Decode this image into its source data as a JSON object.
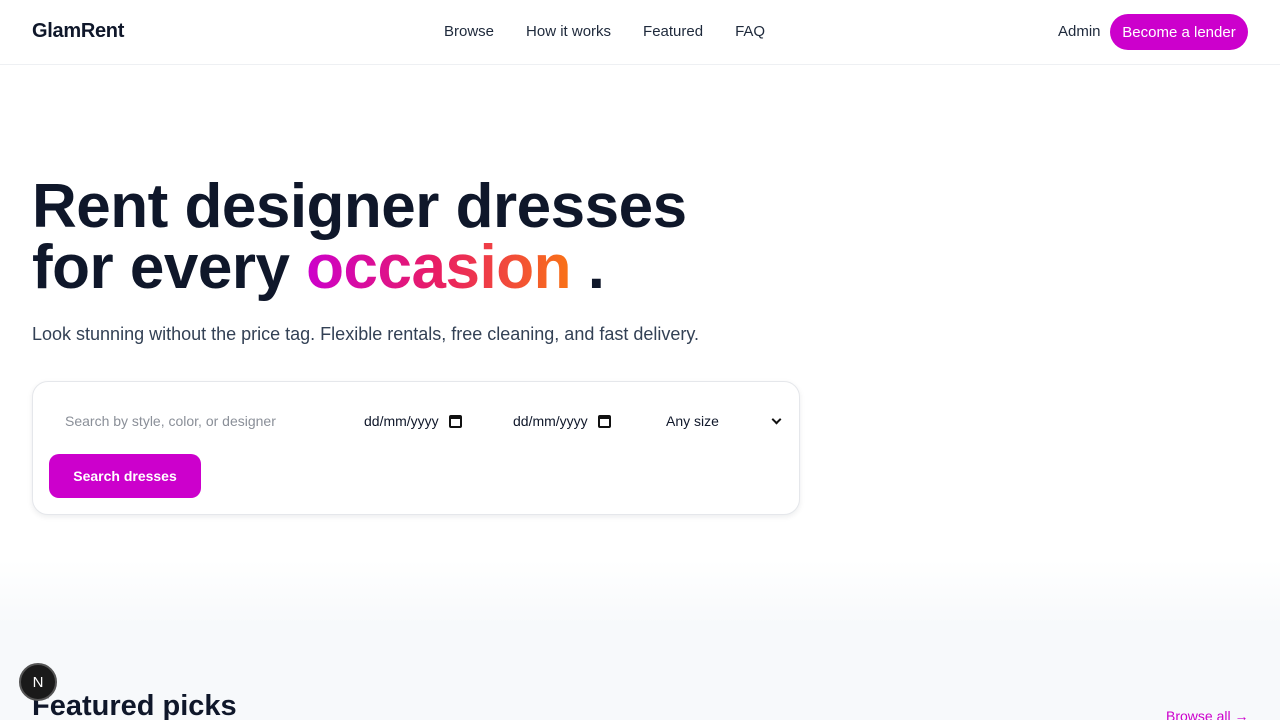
{
  "header": {
    "logo": "GlamRent",
    "nav": [
      "Browse",
      "How it works",
      "Featured",
      "FAQ"
    ],
    "admin_label": "Admin",
    "lender_label": "Become a lender"
  },
  "hero": {
    "title_line1": "Rent designer dresses",
    "title_line2_prefix": "for every",
    "title_accent": "occasion",
    "title_suffix": ".",
    "subtitle": "Look stunning without the price tag. Flexible rentals, free cleaning, and fast delivery."
  },
  "search": {
    "placeholder": "Search by style, color, or designer",
    "start_date_placeholder": "dd/mm/yyyy",
    "end_date_placeholder": "dd/mm/yyyy",
    "size_value": "Any size",
    "button_label": "Search dresses"
  },
  "featured": {
    "title": "Featured picks",
    "browse_all": "Browse all →"
  },
  "dev_badge": "N",
  "colors": {
    "accent": "#cc00cc",
    "gradient": [
      "#cc00cc",
      "#e91e63",
      "#f97316"
    ],
    "text": "#0f172a"
  }
}
